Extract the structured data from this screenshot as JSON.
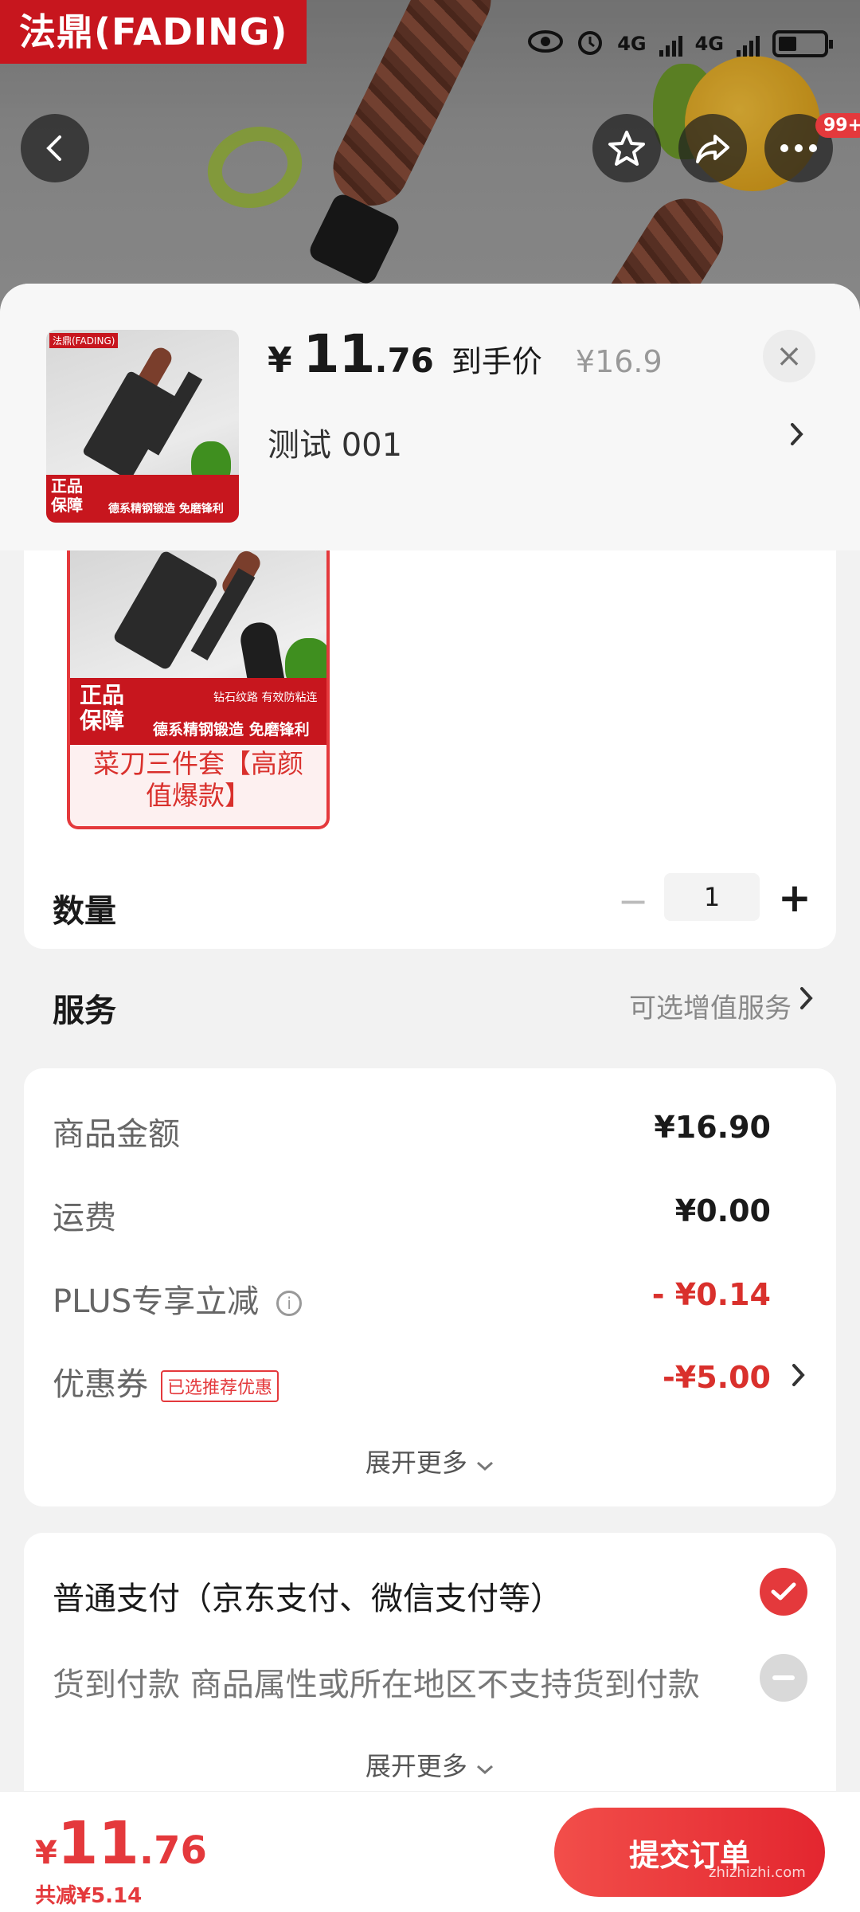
{
  "status_bar": {
    "signal1": "4G",
    "signal2": "4G"
  },
  "hero": {
    "brand": "法鼎(FADING)",
    "badge_more": "99+"
  },
  "sheet": {
    "price_symbol": "¥",
    "price_int": "11",
    "price_dec": ".76",
    "price_tag": "到手价",
    "original_price": "¥16.9",
    "variant_text": "测试 001",
    "close": "×"
  },
  "thumb": {
    "brand": "法鼎(FADING)",
    "banner_big": "正品保障",
    "banner_small": "德系精钢锻造 免磨锋利"
  },
  "spec": {
    "banner_big": "正品保障",
    "banner_small": "德系精钢锻造 免磨锋利",
    "banner_tiny": "钻石纹路 有效防粘连",
    "label": "菜刀三件套【高颜值爆款】"
  },
  "quantity": {
    "label": "数量",
    "value": "1",
    "minus": "−",
    "plus": "+"
  },
  "service": {
    "label": "服务",
    "value": "可选增值服务",
    "arrow": "›"
  },
  "price_details": {
    "items": [
      {
        "label": "商品金额",
        "value": "¥16.90"
      },
      {
        "label": "运费",
        "value": "¥0.00"
      },
      {
        "label": "PLUS专享立减",
        "value": "- ¥0.14"
      },
      {
        "label": "优惠券",
        "value": "-¥5.00",
        "tag": "已选推荐优惠"
      }
    ],
    "expand": "展开更多",
    "info_icon": "i"
  },
  "payment": {
    "options": [
      {
        "label": "普通支付（京东支付、微信支付等）",
        "selected": true
      },
      {
        "label": "货到付款  商品属性或所在地区不支持货到付款",
        "disabled": true
      }
    ],
    "expand": "展开更多"
  },
  "bottom": {
    "symbol": "¥",
    "int": "11",
    "dec": ".76",
    "saved": "共减¥5.14",
    "submit": "提交订单"
  },
  "watermark": "zhizhizhi.com",
  "colors": {
    "accent": "#e4393c",
    "brand_red": "#c7161e"
  }
}
